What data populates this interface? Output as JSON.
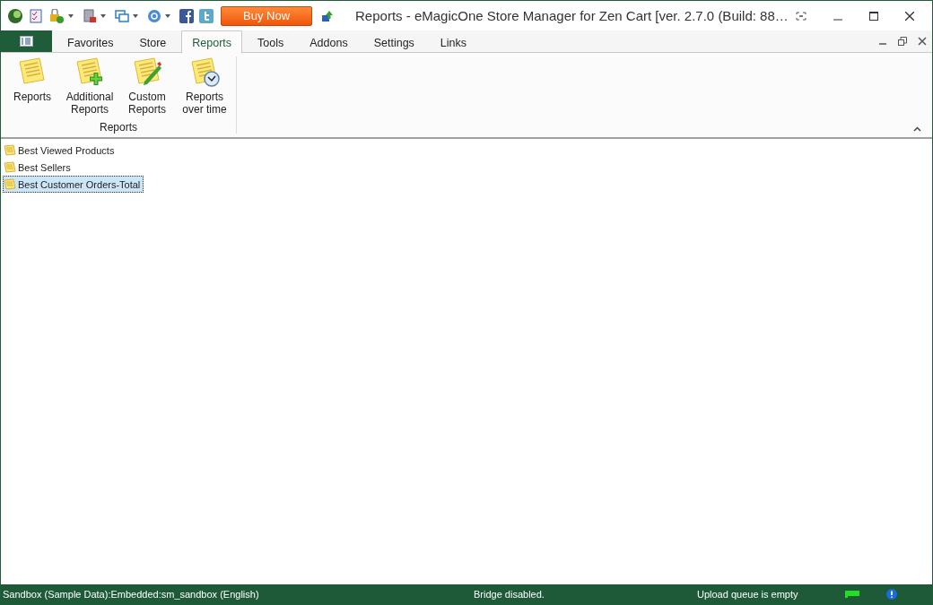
{
  "window": {
    "title": "Reports - eMagicOne Store Manager for Zen Cart [ver. 2.7.0 (Build: 88…"
  },
  "quick_toolbar": {
    "buy_button": "Buy Now"
  },
  "tabs": [
    {
      "label": "Favorites",
      "selected": false
    },
    {
      "label": "Store",
      "selected": false
    },
    {
      "label": "Reports",
      "selected": true
    },
    {
      "label": "Tools",
      "selected": false
    },
    {
      "label": "Addons",
      "selected": false
    },
    {
      "label": "Settings",
      "selected": false
    },
    {
      "label": "Links",
      "selected": false
    }
  ],
  "ribbon": {
    "group_label": "Reports",
    "buttons": [
      {
        "kind": "plain",
        "label": "Reports"
      },
      {
        "kind": "add",
        "label": "Additional Reports"
      },
      {
        "kind": "edit",
        "label": "Custom Reports"
      },
      {
        "kind": "time",
        "label": "Reports over time"
      }
    ]
  },
  "reports": [
    {
      "label": "Best Viewed Products",
      "selected": false
    },
    {
      "label": "Best Sellers",
      "selected": false
    },
    {
      "label": "Best Customer Orders-Total",
      "selected": true
    }
  ],
  "status_bar": {
    "connection": "Sandbox (Sample Data):Embedded:sm_sandbox (English)",
    "bridge": "Bridge disabled.",
    "queue": "Upload queue is empty"
  }
}
